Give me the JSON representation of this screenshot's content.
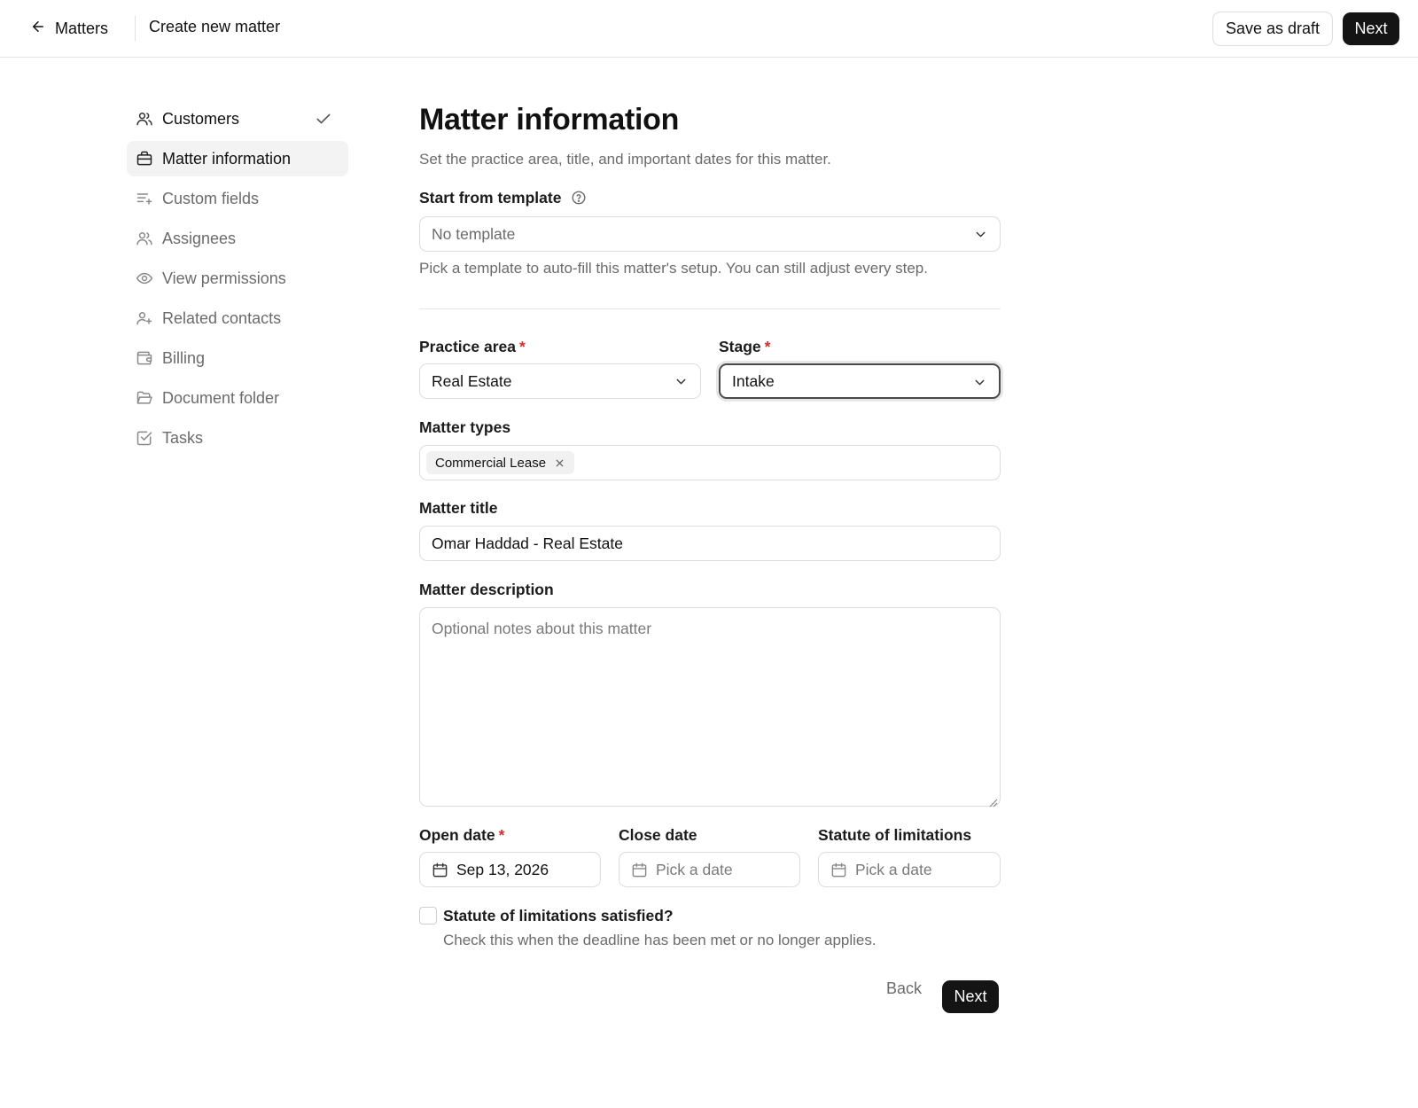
{
  "header": {
    "back_label": "Matters",
    "title": "Create new matter",
    "save_draft_label": "Save as draft",
    "next_label": "Next"
  },
  "sidebar": {
    "items": [
      {
        "label": "Customers",
        "icon": "users-icon",
        "state": "completed"
      },
      {
        "label": "Matter information",
        "icon": "briefcase-icon",
        "state": "active"
      },
      {
        "label": "Custom fields",
        "icon": "list-plus-icon",
        "state": "pending"
      },
      {
        "label": "Assignees",
        "icon": "users-icon",
        "state": "pending"
      },
      {
        "label": "View permissions",
        "icon": "eye-icon",
        "state": "pending"
      },
      {
        "label": "Related contacts",
        "icon": "user-plus-icon",
        "state": "pending"
      },
      {
        "label": "Billing",
        "icon": "wallet-icon",
        "state": "pending"
      },
      {
        "label": "Document folder",
        "icon": "folder-open-icon",
        "state": "pending"
      },
      {
        "label": "Tasks",
        "icon": "check-square-icon",
        "state": "pending"
      }
    ]
  },
  "main": {
    "title": "Matter information",
    "subtitle": "Set the practice area, title, and important dates for this matter.",
    "template": {
      "label": "Start from template",
      "value": "No template",
      "hint": "Pick a template to auto-fill this matter's setup. You can still adjust every step."
    },
    "practice_area": {
      "label": "Practice area",
      "required": "*",
      "value": "Real Estate"
    },
    "stage": {
      "label": "Stage",
      "required": "*",
      "value": "Intake"
    },
    "matter_types": {
      "label": "Matter types",
      "chips": [
        "Commercial Lease"
      ]
    },
    "matter_title": {
      "label": "Matter title",
      "value": "Omar Haddad - Real Estate"
    },
    "description": {
      "label": "Matter description",
      "placeholder": "Optional notes about this matter"
    },
    "open_date": {
      "label": "Open date",
      "required": "*",
      "value": "Sep 13, 2026"
    },
    "close_date": {
      "label": "Close date",
      "placeholder": "Pick a date"
    },
    "statute": {
      "label": "Statute of limitations",
      "placeholder": "Pick a date"
    },
    "statute_satisfied": {
      "label": "Statute of limitations satisfied?",
      "hint": "Check this when the deadline has been met or no longer applies.",
      "checked": false
    },
    "footer": {
      "back_label": "Back",
      "next_label": "Next"
    }
  }
}
